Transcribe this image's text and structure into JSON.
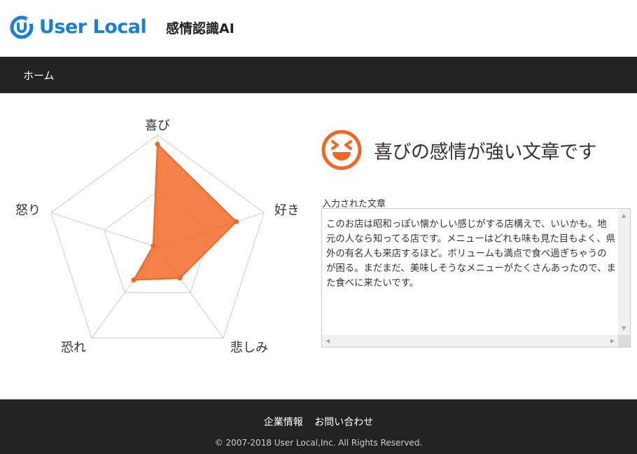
{
  "header": {
    "logo_text": "User Local",
    "product_name": "感情認識AI",
    "brand_color": "#1a7fd6"
  },
  "nav": {
    "items": [
      {
        "label": "ホーム"
      }
    ]
  },
  "radar": {
    "accent_color": "#f26522",
    "axes": [
      "喜び",
      "好き",
      "悲しみ",
      "恐れ",
      "怒り"
    ],
    "values": [
      0.92,
      0.74,
      0.34,
      0.36,
      0.04
    ]
  },
  "result": {
    "icon": "laughing-face-icon",
    "title": "喜びの感情が強い文章です"
  },
  "input": {
    "label": "入力された文章",
    "text": "このお店は昭和っぽい懐かしい感じがする店構えで、いいかも。地元の人なら知ってる店です。メニューはどれも味も見た目もよく、県外の有名人も来店するほど。ボリュームも満点で食べ過ぎちゃうのが困る。まだまだ、美味しそうなメニューがたくさんあったので、また食べに来たいです。"
  },
  "footer": {
    "links": [
      "企業情報",
      "お問い合わせ"
    ],
    "copyright": "© 2007-2018 User Local,Inc. All Rights Reserved."
  }
}
